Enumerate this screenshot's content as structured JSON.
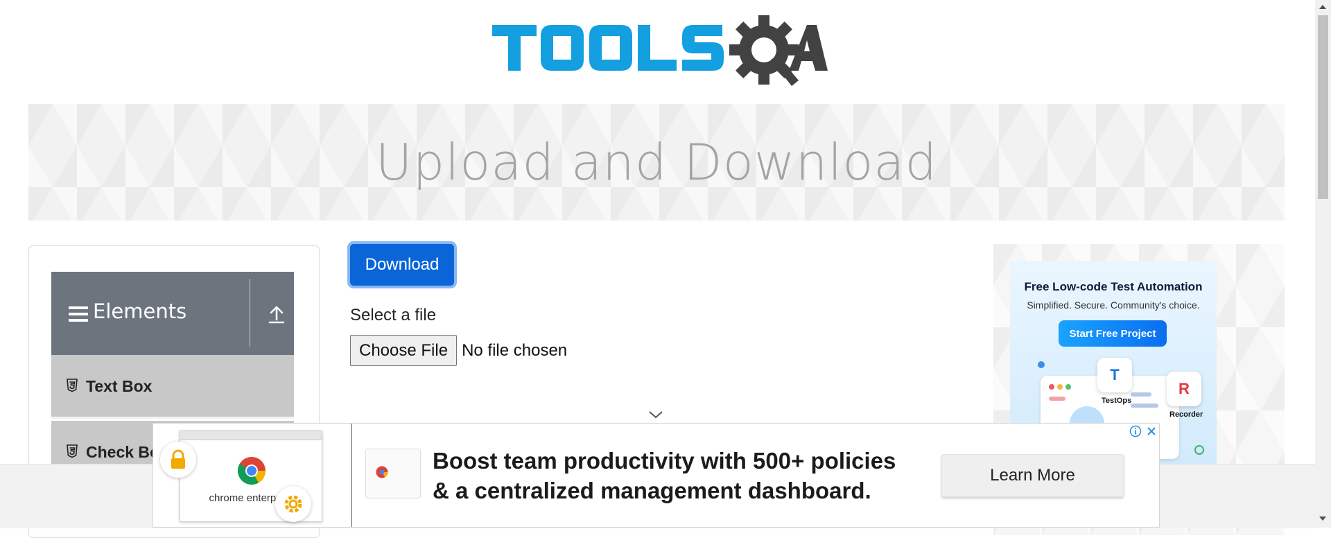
{
  "header": {
    "logo_text": "TOOLSQA"
  },
  "banner": {
    "title": "Upload and Download"
  },
  "sidebar": {
    "group_title": "Elements",
    "items": [
      {
        "label": "Text Box"
      },
      {
        "label": "Check Box"
      }
    ]
  },
  "main": {
    "download_label": "Download",
    "select_label": "Select a file",
    "choose_file_label": "Choose File",
    "file_status": "No file chosen"
  },
  "right_ad": {
    "headline": "Free Low-code Test Automation",
    "subhead": "Simplified. Secure. Community's choice.",
    "cta": "Start Free Project",
    "tile1": "TestOps",
    "tile2": "Recorder"
  },
  "bottom_ad": {
    "brand": "chrome enterprise",
    "line1": "Boost team productivity with 500+ policies",
    "line2": "& a centralized management dashboard.",
    "cta": "Learn More"
  },
  "colors": {
    "accent": "#0a66d8",
    "logo_blue": "#139fe0",
    "logo_gray": "#424242",
    "sidebar_header": "#6c757d",
    "sidebar_item": "#c8c8c8"
  }
}
